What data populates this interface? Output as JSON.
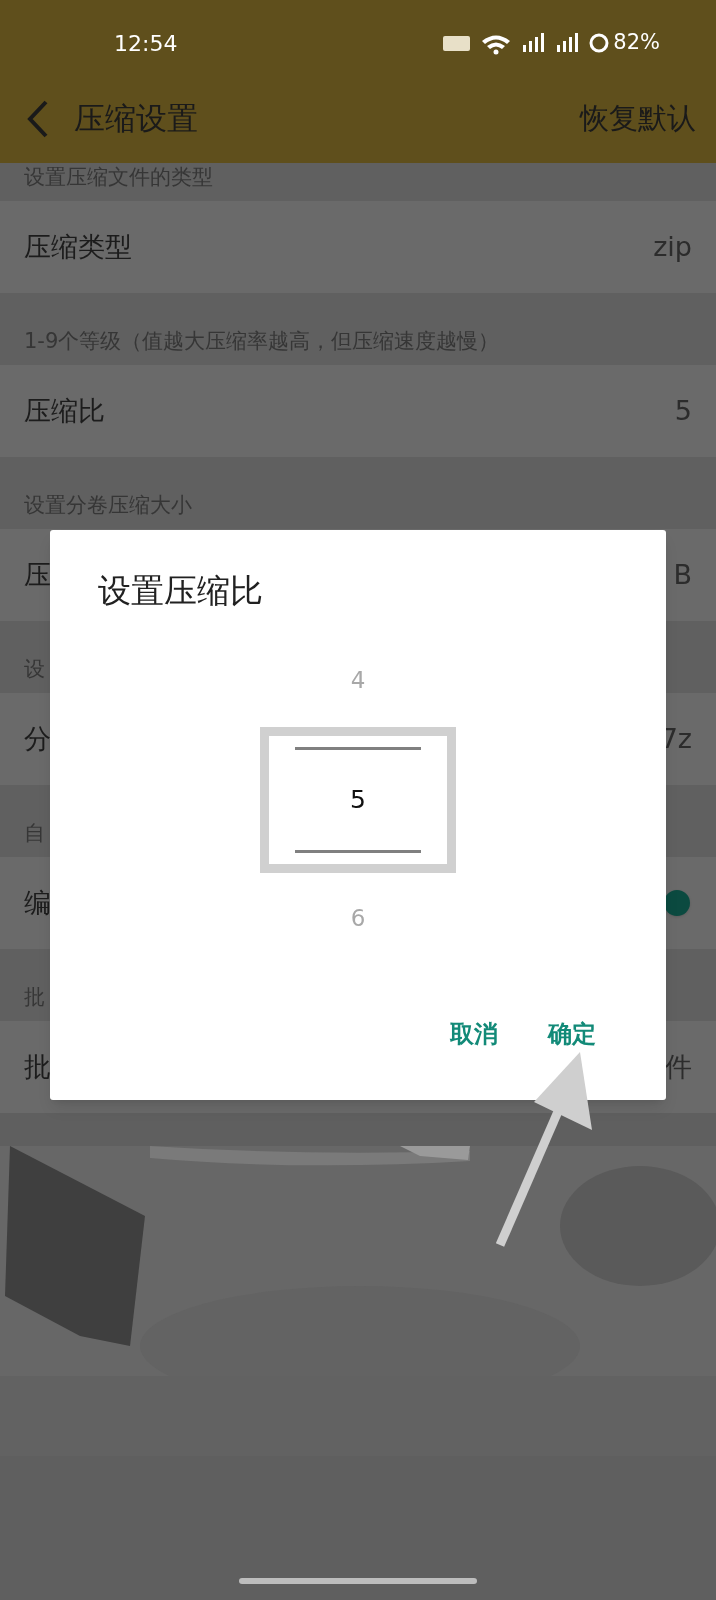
{
  "status_bar": {
    "time": "12:54",
    "battery": "82%"
  },
  "toolbar": {
    "title": "压缩设置",
    "action": "恢复默认"
  },
  "sections": [
    {
      "header": "设置压缩文件的类型",
      "row": {
        "kind": "value",
        "label": "压缩类型",
        "value": "zip"
      }
    },
    {
      "header": "1-9个等级（值越大压缩率越高，但压缩速度越慢）",
      "row": {
        "kind": "value",
        "label": "压缩比",
        "value": "5"
      }
    },
    {
      "header": "设置分卷压缩大小",
      "row": {
        "kind": "value",
        "label": "压",
        "value": "B"
      }
    },
    {
      "header": "设",
      "row": {
        "kind": "value",
        "label": "分",
        "value": "7z"
      }
    },
    {
      "header": "自",
      "row": {
        "kind": "toggle",
        "label": "编",
        "on": true
      }
    },
    {
      "header": "批",
      "row": {
        "kind": "value",
        "label": "批",
        "value": "件"
      }
    }
  ],
  "dialog": {
    "title": "设置压缩比",
    "picker": [
      {
        "label": "4",
        "selected": false
      },
      {
        "label": "5",
        "selected": true
      },
      {
        "label": "6",
        "selected": false
      }
    ],
    "buttons": [
      "取消",
      "确定"
    ]
  }
}
